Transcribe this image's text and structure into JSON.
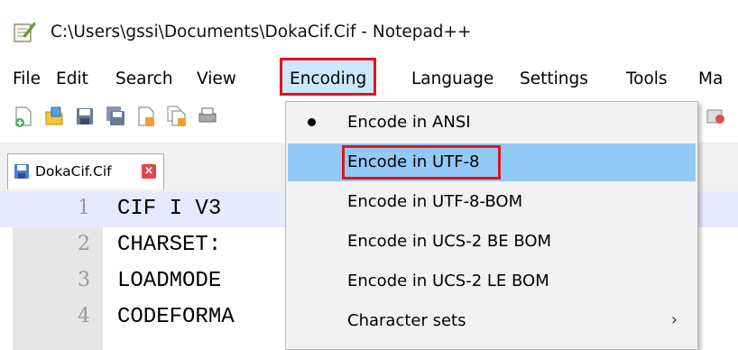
{
  "window": {
    "title": "C:\\Users\\gssi\\Documents\\DokaCif.Cif - Notepad++"
  },
  "menubar": {
    "items": [
      "File",
      "Edit",
      "Search",
      "View",
      "Encoding",
      "Language",
      "Settings",
      "Tools",
      "Ma"
    ],
    "active": "Encoding"
  },
  "toolbar": {
    "icons": [
      "new-file-icon",
      "open-file-icon",
      "save-icon",
      "save-all-icon",
      "close-icon",
      "close-all-icon",
      "print-icon",
      "macro-icon"
    ]
  },
  "tabs": [
    {
      "label": "DokaCif.Cif",
      "close": "×"
    }
  ],
  "editor": {
    "lines": [
      {
        "number": "1",
        "text": "CIF I V3"
      },
      {
        "number": "2",
        "text": "CHARSET:"
      },
      {
        "number": "3",
        "text": "LOADMODE"
      },
      {
        "number": "4",
        "text": "CODEFORMA"
      }
    ]
  },
  "encoding_menu": {
    "items": [
      {
        "label": "Encode in ANSI",
        "checked": true
      },
      {
        "label": "Encode in UTF-8",
        "hovered": true
      },
      {
        "label": "Encode in UTF-8-BOM"
      },
      {
        "label": "Encode in UCS-2 BE BOM"
      },
      {
        "label": "Encode in UCS-2 LE BOM"
      },
      {
        "label": "Character sets",
        "submenu": true,
        "arrow": "›"
      }
    ]
  },
  "colors": {
    "highlight_border": "#e0141e",
    "menu_hover": "#91c9f7",
    "current_line": "#e8e8ff"
  }
}
